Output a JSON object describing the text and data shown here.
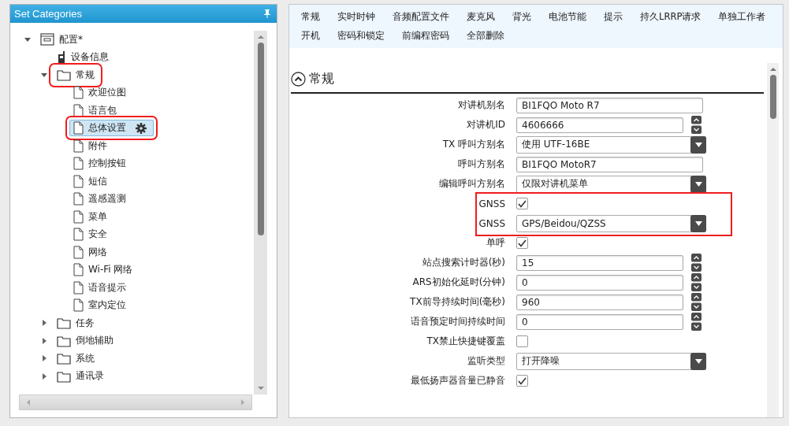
{
  "sidebar": {
    "title": "Set Categories",
    "tree": [
      {
        "label": "配置*",
        "kind": "root",
        "expanded": true,
        "selected": false,
        "highlighted": false,
        "children": [
          {
            "label": "设备信息",
            "kind": "device",
            "selected": false,
            "highlighted": false
          },
          {
            "label": "常规",
            "kind": "folder",
            "expanded": true,
            "selected": false,
            "highlighted": true,
            "children": [
              {
                "label": "欢迎位图",
                "kind": "page",
                "selected": false,
                "highlighted": false
              },
              {
                "label": "语言包",
                "kind": "page",
                "selected": false,
                "highlighted": false
              },
              {
                "label": "总体设置",
                "kind": "page",
                "selected": true,
                "highlighted": true
              },
              {
                "label": "附件",
                "kind": "page",
                "selected": false,
                "highlighted": false
              },
              {
                "label": "控制按钮",
                "kind": "page",
                "selected": false,
                "highlighted": false
              },
              {
                "label": "短信",
                "kind": "page",
                "selected": false,
                "highlighted": false
              },
              {
                "label": "遥感遥测",
                "kind": "page",
                "selected": false,
                "highlighted": false
              },
              {
                "label": "菜单",
                "kind": "page",
                "selected": false,
                "highlighted": false
              },
              {
                "label": "安全",
                "kind": "page",
                "selected": false,
                "highlighted": false
              },
              {
                "label": "网络",
                "kind": "page",
                "selected": false,
                "highlighted": false
              },
              {
                "label": "Wi-Fi 网络",
                "kind": "page",
                "selected": false,
                "highlighted": false
              },
              {
                "label": "语音提示",
                "kind": "page",
                "selected": false,
                "highlighted": false
              },
              {
                "label": "室内定位",
                "kind": "page",
                "selected": false,
                "highlighted": false
              }
            ]
          },
          {
            "label": "任务",
            "kind": "folder",
            "expanded": false,
            "selected": false,
            "highlighted": false
          },
          {
            "label": "倒地辅助",
            "kind": "folder",
            "expanded": false,
            "selected": false,
            "highlighted": false
          },
          {
            "label": "系统",
            "kind": "folder",
            "expanded": false,
            "selected": false,
            "highlighted": false
          },
          {
            "label": "通讯录",
            "kind": "folder",
            "expanded": false,
            "selected": false,
            "highlighted": false
          }
        ]
      }
    ]
  },
  "tabs": [
    {
      "label": "常规",
      "selected": false
    },
    {
      "label": "实时时钟",
      "selected": false
    },
    {
      "label": "音频配置文件",
      "selected": false
    },
    {
      "label": "麦克风",
      "selected": false
    },
    {
      "label": "背光",
      "selected": false
    },
    {
      "label": "电池节能",
      "selected": false
    },
    {
      "label": "提示",
      "selected": false
    },
    {
      "label": "持久LRRP请求",
      "selected": false
    },
    {
      "label": "单独工作者",
      "selected": false
    },
    {
      "label": "开机",
      "selected": false
    },
    {
      "label": "密码和锁定",
      "selected": false
    },
    {
      "label": "前编程密码",
      "selected": false
    },
    {
      "label": "全部删除",
      "selected": false
    }
  ],
  "section": {
    "title": "常规",
    "expanded": true,
    "rows": [
      {
        "label": "对讲机别名",
        "kind": "text",
        "value": "BI1FQO Moto R7",
        "highlighted": false
      },
      {
        "label": "对讲机ID",
        "kind": "spin",
        "value": "4606666",
        "highlighted": false
      },
      {
        "label": "TX 呼叫方别名",
        "kind": "select",
        "value": "使用 UTF-16BE",
        "highlighted": false
      },
      {
        "label": "呼叫方别名",
        "kind": "text",
        "value": "BI1FQO MotoR7",
        "highlighted": false
      },
      {
        "label": "编辑呼叫方别名",
        "kind": "select",
        "value": "仅限对讲机菜单",
        "highlighted": false
      },
      {
        "label": "GNSS",
        "kind": "checkbox",
        "checked": true,
        "highlighted": true
      },
      {
        "label": "GNSS",
        "kind": "select",
        "value": "GPS/Beidou/QZSS",
        "highlighted": true
      },
      {
        "label": "单呼",
        "kind": "checkbox",
        "checked": true,
        "highlighted": false
      },
      {
        "label": "站点搜索计时器(秒)",
        "kind": "spin",
        "value": "15",
        "highlighted": false
      },
      {
        "label": "ARS初始化延时(分钟)",
        "kind": "spin",
        "value": "0",
        "highlighted": false
      },
      {
        "label": "TX前导持续时间(毫秒)",
        "kind": "spin",
        "value": "960",
        "highlighted": false
      },
      {
        "label": "语音预定时间持续时间",
        "kind": "spin",
        "value": "0",
        "highlighted": false
      },
      {
        "label": "TX禁止快捷键覆盖",
        "kind": "checkbox",
        "checked": false,
        "highlighted": false
      },
      {
        "label": "监听类型",
        "kind": "select",
        "value": "打开降噪",
        "highlighted": false
      },
      {
        "label": "最低扬声器音量已静音",
        "kind": "checkbox",
        "checked": true,
        "highlighted": false
      }
    ]
  }
}
